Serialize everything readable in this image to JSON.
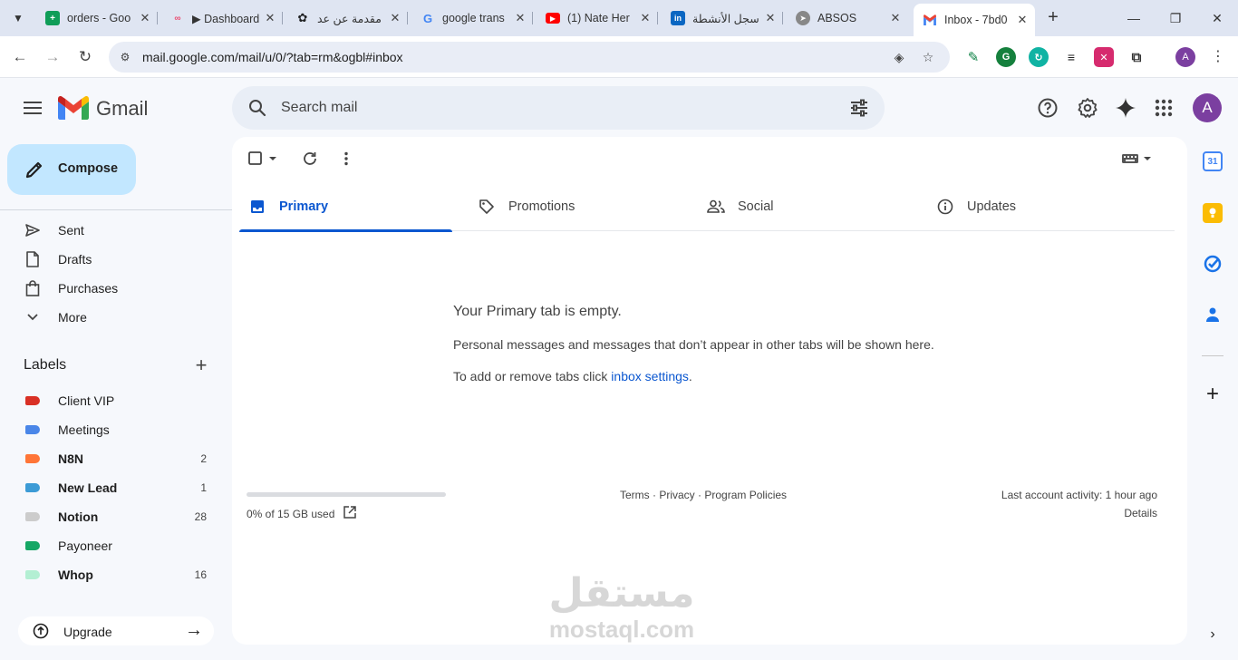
{
  "browser": {
    "tabs": [
      {
        "title": "orders - Goo",
        "icon": "sheets-icon",
        "color": "#0f9d58"
      },
      {
        "title": "▶ Dashboard",
        "icon": "n8n-icon",
        "color": "#ea4b71"
      },
      {
        "title": "مقدمة عن عد",
        "icon": "chatgpt-icon",
        "color": "#202123"
      },
      {
        "title": "google trans",
        "icon": "google-icon",
        "color": "#4285f4"
      },
      {
        "title": "(1) Nate Her",
        "icon": "youtube-icon",
        "color": "#ff0000"
      },
      {
        "title": "سجل الأنشطة",
        "icon": "linkedin-icon",
        "color": "#0a66c2"
      },
      {
        "title": "ABSOS",
        "icon": "compass-icon",
        "color": "#777777"
      },
      {
        "title": "Inbox - 7bd0",
        "icon": "gmail-icon",
        "color": "#ea4335"
      }
    ],
    "url": "mail.google.com/mail/u/0/?tab=rm&ogbl#inbox",
    "profile_initial": "A"
  },
  "gmail": {
    "brand": "Gmail",
    "search_placeholder": "Search mail",
    "avatar_initial": "A",
    "compose_label": "Compose",
    "nav": [
      {
        "label": "Sent",
        "icon": "send-icon"
      },
      {
        "label": "Drafts",
        "icon": "draft-icon"
      },
      {
        "label": "Purchases",
        "icon": "shopping-bag-icon"
      },
      {
        "label": "More",
        "icon": "chevron-down-icon"
      }
    ],
    "labels_heading": "Labels",
    "labels": [
      {
        "name": "Client VIP",
        "count": "",
        "color": "#d93025",
        "bold": false
      },
      {
        "name": "Meetings",
        "count": "",
        "color": "#4a86e8",
        "bold": false
      },
      {
        "name": "N8N",
        "count": "2",
        "color": "#ff7537",
        "bold": true
      },
      {
        "name": "New Lead",
        "count": "1",
        "color": "#3c9bd6",
        "bold": true
      },
      {
        "name": "Notion",
        "count": "28",
        "color": "#cccccc",
        "bold": true
      },
      {
        "name": "Payoneer",
        "count": "",
        "color": "#16a765",
        "bold": false
      },
      {
        "name": "Whop",
        "count": "16",
        "color": "#b3efd3",
        "bold": true
      }
    ],
    "upgrade_label": "Upgrade",
    "inbox_tabs": [
      {
        "label": "Primary",
        "icon": "inbox-icon",
        "active": true
      },
      {
        "label": "Promotions",
        "icon": "tag-icon",
        "active": false
      },
      {
        "label": "Social",
        "icon": "people-icon",
        "active": false
      },
      {
        "label": "Updates",
        "icon": "info-icon",
        "active": false
      }
    ],
    "empty": {
      "title": "Your Primary tab is empty.",
      "line1": "Personal messages and messages that don’t appear in other tabs will be shown here.",
      "line2_prefix": "To add or remove tabs click ",
      "line2_link": "inbox settings",
      "line2_suffix": "."
    },
    "storage": {
      "text": "0% of 15 GB used",
      "fraction": 0.0
    },
    "footer": {
      "terms": "Terms",
      "privacy": "Privacy",
      "policies": "Program Policies",
      "sep": " · "
    },
    "activity": "Last account activity: 1 hour ago",
    "details": "Details"
  },
  "watermark": {
    "arabic": "مستقل",
    "latin": "mostaql.com"
  },
  "colors": {
    "accent": "#0b57d0",
    "compose_bg": "#c2e7ff",
    "page_bg": "#f6f8fc",
    "avatar": "#7b3fa0"
  }
}
